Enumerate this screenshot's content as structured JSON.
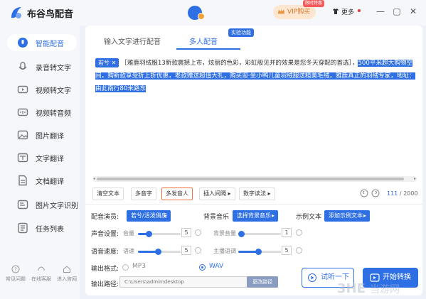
{
  "app": {
    "title": "布谷鸟配音"
  },
  "header": {
    "vip_label": "VIP购买",
    "vip_badge": "限时特惠",
    "more_label": "更多",
    "window_controls": [
      "—",
      "▢",
      "✕"
    ]
  },
  "sidebar": {
    "items": [
      {
        "label": "智能配音",
        "icon": "microphone-icon",
        "active": true
      },
      {
        "label": "录音转文字",
        "icon": "record-icon",
        "active": false
      },
      {
        "label": "视频转文字",
        "icon": "video-icon",
        "active": false
      },
      {
        "label": "视频转音频",
        "icon": "video-audio-icon",
        "active": false
      },
      {
        "label": "图片翻译",
        "icon": "image-icon",
        "active": false
      },
      {
        "label": "文字翻译",
        "icon": "translate-icon",
        "active": false
      },
      {
        "label": "文档翻译",
        "icon": "document-icon",
        "active": false
      },
      {
        "label": "图片文字识别",
        "icon": "ocr-icon",
        "active": false
      },
      {
        "label": "任务列表",
        "icon": "task-list-icon",
        "active": false
      }
    ],
    "bottom_links": [
      {
        "label": "常见问题",
        "icon": "question-icon"
      },
      {
        "label": "在线客服",
        "icon": "headset-icon"
      },
      {
        "label": "进入官网",
        "icon": "home-icon"
      }
    ]
  },
  "tabs": {
    "text_dubbing": "输入文字进行配音",
    "multi_dubbing": "多人配音",
    "lab_badge": "实验功能"
  },
  "editor": {
    "speaker_tag": "若兮 ✕",
    "text_plain": "［雅鹿羽绒服13新款震撼上市，炫丽的色彩，彩虹般见并的效果是您冬天穿配的首选］，",
    "text_highlight_1": "500平米超大购物空间，购新款享受折上折优惠，老款赠送超值大礼，购买迎·坐小鸭儿童羽绒服送精美毛绒，雅鹿真正的羽绒专家，地址：由此南行80米路东"
  },
  "toolbar": {
    "clear": "清空文本",
    "polyphone": "多音字",
    "multi_speaker": "多发音人",
    "insert_pause": "插入间隔 ▸",
    "number_read": "数字读法 ▸",
    "char_count": "111",
    "char_limit": "/ 2000"
  },
  "settings": {
    "speaker_label": "配音演员:",
    "speaker_value": "若兮/活泼俏皮",
    "bgm_label": "背景音乐",
    "bgm_value": "选择背景音乐",
    "sample_label": "示例文本",
    "sample_value": "添加示例文本",
    "volume_label": "声音设置:",
    "volume_sub": "音量",
    "volume_value": "5",
    "bg_volume_sub": "背景音量",
    "bg_volume_value": "1",
    "speed_label": "语音速度:",
    "speed_sub": "语速",
    "speed_value": "5",
    "pitch_sub": "主播语调",
    "pitch_value": "5",
    "format_label": "输出格式:",
    "format_mp3": "MP3",
    "format_wav": "WAV",
    "path_label": "输出路径:",
    "path_value": "C:\\Users\\admin\\desktop",
    "path_button": "更改路径",
    "audition_button": "试听一下",
    "convert_button": "开始转换"
  },
  "watermark": {
    "text": "3HE当游网"
  },
  "colors": {
    "accent": "#2f6fe4",
    "highlight_border": "#f07040"
  }
}
